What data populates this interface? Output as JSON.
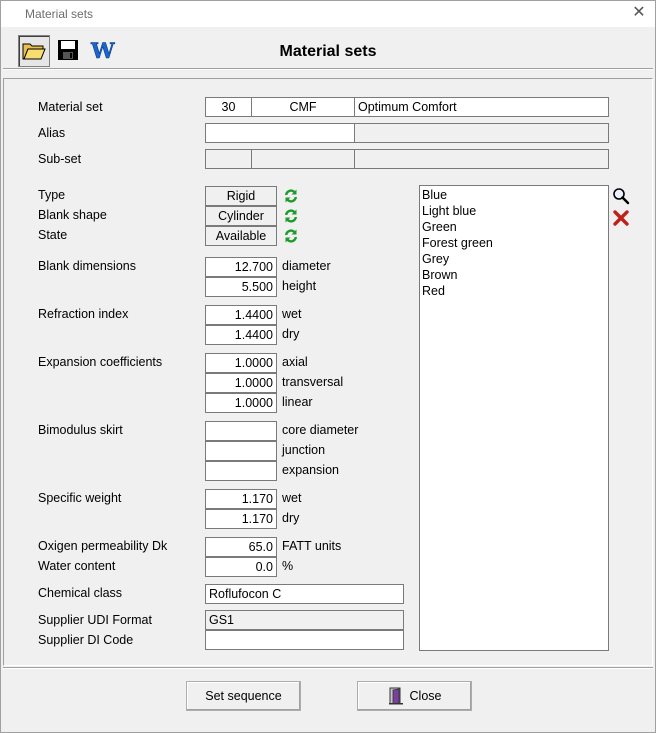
{
  "window": {
    "title": "Material sets",
    "heading": "Material sets"
  },
  "toolbar": {
    "icons": [
      "folder-open-icon",
      "save-disk-icon",
      "word-icon"
    ]
  },
  "labels": {
    "material_set": "Material set",
    "alias": "Alias",
    "sub_set": "Sub-set",
    "type": "Type",
    "blank_shape": "Blank shape",
    "state": "State",
    "blank_dimensions": "Blank dimensions",
    "refraction_index": "Refraction index",
    "expansion_coefficients": "Expansion coefficients",
    "bimodulus_skirt": "Bimodulus skirt",
    "specific_weight": "Specific weight",
    "oxigen_permeability": "Oxigen permeability Dk",
    "water_content": "Water content",
    "chemical_class": "Chemical class",
    "supplier_udi_format": "Supplier UDI Format",
    "supplier_di_code": "Supplier DI Code"
  },
  "fields": {
    "material_set": {
      "number": "30",
      "code": "CMF",
      "name": "Optimum Comfort"
    },
    "alias": {
      "a": "",
      "b": ""
    },
    "sub_set": {
      "a": "",
      "b": "",
      "c": ""
    },
    "type": "Rigid",
    "blank_shape": "Cylinder",
    "state": "Available",
    "blank_dimensions": {
      "diameter": "12.700",
      "height": "5.500"
    },
    "refraction_index": {
      "wet": "1.4400",
      "dry": "1.4400"
    },
    "expansion": {
      "axial": "1.0000",
      "transversal": "1.0000",
      "linear": "1.0000"
    },
    "bimodulus": {
      "core_diameter": "",
      "junction": "",
      "expansion": ""
    },
    "specific_weight": {
      "wet": "1.170",
      "dry": "1.170"
    },
    "oxigen_permeability": "65.0",
    "water_content": "0.0",
    "chemical_class": "Roflufocon C",
    "supplier_udi_format": "GS1",
    "supplier_di_code": ""
  },
  "units": {
    "diameter": "diameter",
    "height": "height",
    "wet": "wet",
    "dry": "dry",
    "axial": "axial",
    "transversal": "transversal",
    "linear": "linear",
    "core_diameter": "core diameter",
    "junction": "junction",
    "expansion": "expansion",
    "fatt_units": "FATT units",
    "percent": "%"
  },
  "colors": {
    "list": [
      "Blue",
      "Light blue",
      "Green",
      "Forest green",
      "Grey",
      "Brown",
      "Red"
    ]
  },
  "buttons": {
    "set_sequence": "Set sequence",
    "close": "Close"
  }
}
